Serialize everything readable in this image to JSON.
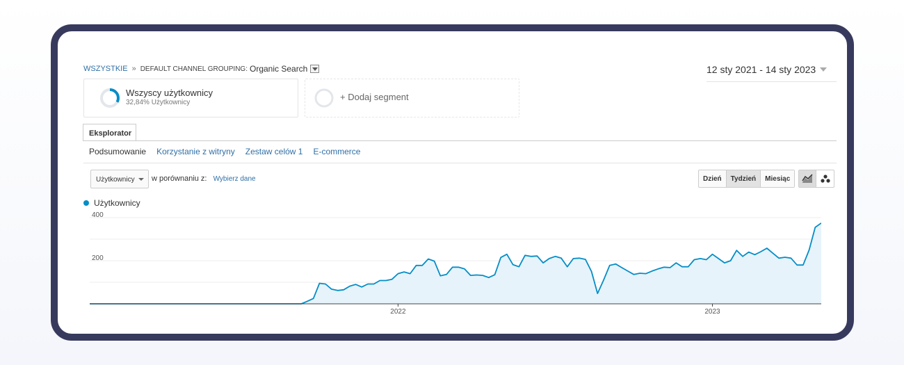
{
  "breadcrumb": {
    "root": "WSZYSTKIE",
    "separator": "»",
    "dimension": "DEFAULT CHANNEL GROUPING:",
    "value": "Organic Search"
  },
  "date_range": "12 sty 2021 - 14 sty 2023",
  "segments": {
    "primary": {
      "name": "Wszyscy użytkownicy",
      "detail": "32,84% Użytkownicy",
      "percent": 32.84
    },
    "add": "+ Dodaj segment"
  },
  "tab": "Eksplorator",
  "subtabs": [
    "Podsumowanie",
    "Korzystanie z witryny",
    "Zestaw celów 1",
    "E-commerce"
  ],
  "metric_select": "Użytkownicy",
  "compare": {
    "label": "w porównaniu z:",
    "link": "Wybierz dane"
  },
  "granularity": [
    "Dzień",
    "Tydzień",
    "Miesiąc"
  ],
  "granularity_selected": "Tydzień",
  "chart_icons": [
    "line-chart-icon",
    "motion-chart-icon"
  ],
  "colors": {
    "series": "#058dc7",
    "area": "#e6f3fa",
    "link": "#2f6fa6",
    "frame": "#373a5c"
  },
  "chart_data": {
    "type": "area",
    "series": [
      {
        "name": "Użytkownicy",
        "values": [
          0,
          0,
          0,
          0,
          0,
          0,
          0,
          0,
          0,
          0,
          0,
          0,
          0,
          0,
          0,
          0,
          0,
          0,
          0,
          0,
          0,
          0,
          0,
          0,
          0,
          0,
          0,
          0,
          0,
          0,
          0,
          0,
          0,
          0,
          0,
          0,
          12,
          25,
          95,
          92,
          68,
          62,
          65,
          82,
          90,
          78,
          92,
          92,
          108,
          108,
          114,
          140,
          148,
          140,
          178,
          178,
          208,
          198,
          130,
          136,
          170,
          170,
          162,
          132,
          134,
          132,
          122,
          135,
          215,
          230,
          182,
          172,
          225,
          220,
          222,
          190,
          210,
          220,
          212,
          172,
          210,
          212,
          206,
          150,
          48,
          110,
          178,
          185,
          168,
          152,
          136,
          142,
          140,
          152,
          162,
          170,
          168,
          190,
          172,
          172,
          205,
          210,
          205,
          230,
          210,
          190,
          200,
          248,
          220,
          240,
          228,
          242,
          258,
          235,
          212,
          216,
          212,
          180,
          180,
          250,
          355,
          375
        ]
      }
    ],
    "x_ticks": [
      "2022",
      "2023"
    ],
    "y_ticks": [
      200,
      400
    ],
    "ylim": [
      0,
      400
    ],
    "grid": true
  }
}
